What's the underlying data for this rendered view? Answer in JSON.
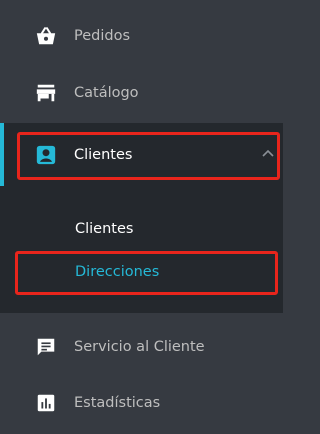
{
  "sidebar": {
    "items": [
      {
        "label": "Pedidos",
        "icon": "shopping-basket-icon"
      },
      {
        "label": "Catálogo",
        "icon": "store-icon"
      },
      {
        "label": "Clientes",
        "icon": "account-circle-icon",
        "expanded": true
      },
      {
        "label": "Servicio al Cliente",
        "icon": "chat-icon"
      },
      {
        "label": "Estadísticas",
        "icon": "bar-chart-icon"
      }
    ],
    "submenu": [
      {
        "label": "Clientes",
        "active": false
      },
      {
        "label": "Direcciones",
        "active": true
      }
    ]
  },
  "colors": {
    "sidebar_bg": "#363a41",
    "active_bg": "#24282d",
    "accent": "#25b9d7",
    "highlight_border": "#e8251c",
    "text": "#bebebe",
    "text_active": "#ffffff"
  }
}
